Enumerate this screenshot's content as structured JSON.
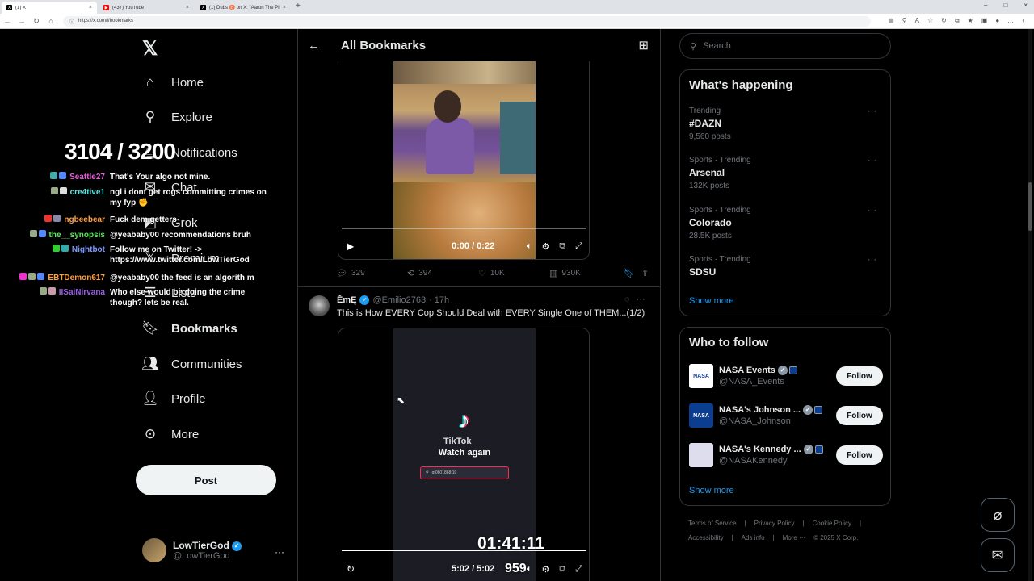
{
  "browser": {
    "tabs": [
      {
        "title": "(1) X",
        "icon": "x-icon"
      },
      {
        "title": "(437) YouTube",
        "icon": "youtube-icon"
      },
      {
        "title": "(1) Dubs ♉ on X: \"Aaron The Plu…",
        "icon": "x-icon"
      }
    ],
    "url": "https://x.com/i/bookmarks"
  },
  "sidebar": {
    "items": [
      {
        "label": "Home",
        "icon": "home-icon"
      },
      {
        "label": "Explore",
        "icon": "search-icon"
      },
      {
        "label": "Notifications",
        "icon": "bell-icon"
      },
      {
        "label": "Chat",
        "icon": "mail-icon"
      },
      {
        "label": "Grok",
        "icon": "grok-icon"
      },
      {
        "label": "Premium",
        "icon": "x-icon"
      },
      {
        "label": "Lists",
        "icon": "list-icon"
      },
      {
        "label": "Bookmarks",
        "icon": "bookmark-icon"
      },
      {
        "label": "Communities",
        "icon": "communities-icon"
      },
      {
        "label": "Profile",
        "icon": "profile-icon"
      },
      {
        "label": "More",
        "icon": "more-circle-icon"
      }
    ],
    "post_label": "Post",
    "user": {
      "name": "LowTierGod",
      "handle": "@LowTierGod"
    }
  },
  "overlay": {
    "counter": "3104 / 3200",
    "chat": [
      {
        "user": "Seattle27",
        "color": "#e35fd6",
        "msg": "That's Your algo not mine."
      },
      {
        "user": "cre4tive1",
        "color": "#5fe3e3",
        "msg": "ngl i dont get rogs committing crimes on my fyp ✊"
      },
      {
        "user": "ngbeebear",
        "color": "#ff9f40",
        "msg": "Fuck dem getters"
      },
      {
        "user": "the__synopsis",
        "color": "#5fe35f",
        "msg": "@yeababy00 recommendations bruh"
      },
      {
        "user": "Nightbot",
        "color": "#7e9bff",
        "msg": "Follow me on Twitter! -> https://www.twitter.com/LowTierGod"
      },
      {
        "user": "EBTDemon617",
        "color": "#ff9f40",
        "msg": "@yeababy00 the feed is an algorith m"
      },
      {
        "user": "IISaiNirvana",
        "color": "#9b5fe3",
        "msg": "Who else would be doing the crime though? lets be real."
      }
    ],
    "timer": "01:41:11",
    "number": "959"
  },
  "main": {
    "title": "All Bookmarks",
    "tweet1": {
      "video_time": "0:00 / 0:22",
      "progress": 0.0,
      "stats": {
        "replies": "329",
        "reposts": "394",
        "likes": "10K",
        "views": "930K"
      }
    },
    "tweet2": {
      "name": "ĔmĘ",
      "handle": "@Emilio2763",
      "time": "· 17h",
      "text": "This is How EVERY Cop Should Deal with EVERY Single One of THEM...(1/2)",
      "tiktok_word": "TikTok",
      "watch_again": "Watch again",
      "tiktok_search": "gt0601868:10",
      "video_time": "5:02 / 5:02",
      "progress": 1.0
    }
  },
  "right": {
    "search_placeholder": "Search",
    "whats_happening": "What's happening",
    "trends": [
      {
        "category": "Trending",
        "name": "#DAZN",
        "count": "9,560 posts"
      },
      {
        "category": "Sports · Trending",
        "name": "Arsenal",
        "count": "132K posts"
      },
      {
        "category": "Sports · Trending",
        "name": "Colorado",
        "count": "28.5K posts"
      },
      {
        "category": "Sports · Trending",
        "name": "SDSU",
        "count": ""
      }
    ],
    "show_more": "Show more",
    "who_to_follow": "Who to follow",
    "follow": [
      {
        "name": "NASA Events",
        "handle": "@NASA_Events"
      },
      {
        "name": "NASA's Johnson ...",
        "handle": "@NASA_Johnson"
      },
      {
        "name": "NASA's Kennedy ...",
        "handle": "@NASAKennedy"
      }
    ],
    "follow_label": "Follow",
    "footer": [
      "Terms of Service",
      "Privacy Policy",
      "Cookie Policy",
      "Accessibility",
      "Ads info",
      "More ···",
      "© 2025 X Corp."
    ]
  }
}
